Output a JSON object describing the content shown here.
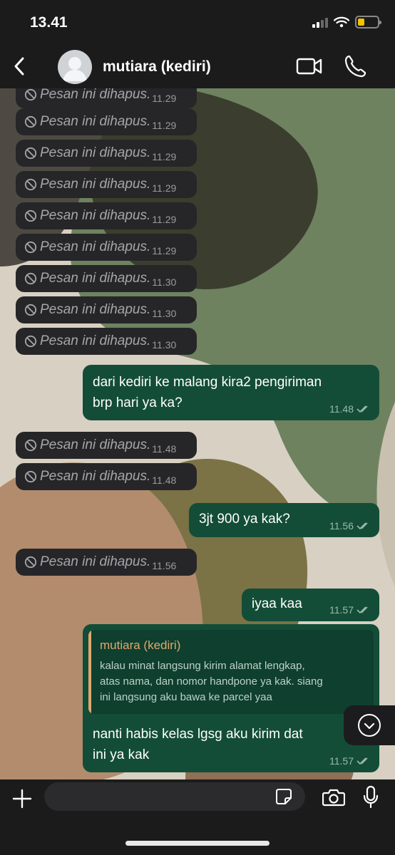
{
  "status_bar": {
    "time": "13.41"
  },
  "header": {
    "contact_name": "mutiara (kediri)"
  },
  "deleted_text": "Pesan ini dihapus.",
  "messages": {
    "d0": {
      "text": "Pesan ini dihapus.",
      "time": "11.29"
    },
    "d1": {
      "text": "Pesan ini dihapus.",
      "time": "11.29"
    },
    "d2": {
      "text": "Pesan ini dihapus.",
      "time": "11.29"
    },
    "d3": {
      "text": "Pesan ini dihapus.",
      "time": "11.29"
    },
    "d4": {
      "text": "Pesan ini dihapus.",
      "time": "11.29"
    },
    "d5": {
      "text": "Pesan ini dihapus.",
      "time": "11.29"
    },
    "d6": {
      "text": "Pesan ini dihapus.",
      "time": "11.30"
    },
    "d7": {
      "text": "Pesan ini dihapus.",
      "time": "11.30"
    },
    "d8": {
      "text": "Pesan ini dihapus.",
      "time": "11.30"
    },
    "o1": {
      "line1": "dari kediri ke malang kira2 pengiriman",
      "line2": "brp hari ya ka?",
      "time": "11.48"
    },
    "d9": {
      "text": "Pesan ini dihapus.",
      "time": "11.48"
    },
    "d10": {
      "text": "Pesan ini dihapus.",
      "time": "11.48"
    },
    "o2": {
      "text": "3jt 900 ya kak?",
      "time": "11.56"
    },
    "d11": {
      "text": "Pesan ini dihapus.",
      "time": "11.56"
    },
    "o3": {
      "text": "iyaa kaa",
      "time": "11.57"
    },
    "o4": {
      "quote_name": "mutiara (kediri)",
      "quote_line1": "kalau minat langsung kirim alamat lengkap,",
      "quote_line2": "atas nama, dan nomor handpone ya kak. siang",
      "quote_line3": "ini langsung aku bawa ke parcel yaa",
      "line1": "nanti habis kelas lgsg aku kirim dat",
      "line2": "ini ya kak",
      "time": "11.57"
    }
  },
  "input": {
    "placeholder": ""
  },
  "colors": {
    "outgoing": "#134d38",
    "incoming": "#262628",
    "quote_accent": "#e0a86e"
  }
}
